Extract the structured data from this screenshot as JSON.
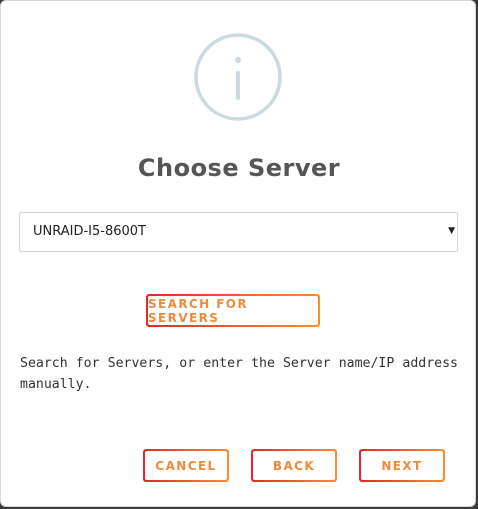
{
  "dialog": {
    "icon": "info-icon",
    "title": "Choose Server",
    "server_select": {
      "selected": "UNRAID-I5-8600T"
    },
    "search_button_label": "SEARCH FOR SERVERS",
    "description": "Search for Servers, or enter the Server name/IP address manually.",
    "buttons": {
      "cancel_label": "CANCEL",
      "back_label": "BACK",
      "next_label": "NEXT"
    }
  },
  "colors": {
    "accent_gradient_start": "#e22828",
    "accent_gradient_end": "#ff8c2f",
    "button_text": "#f28a3b",
    "icon_stroke": "#c9dbe1",
    "title_text": "#555555"
  }
}
